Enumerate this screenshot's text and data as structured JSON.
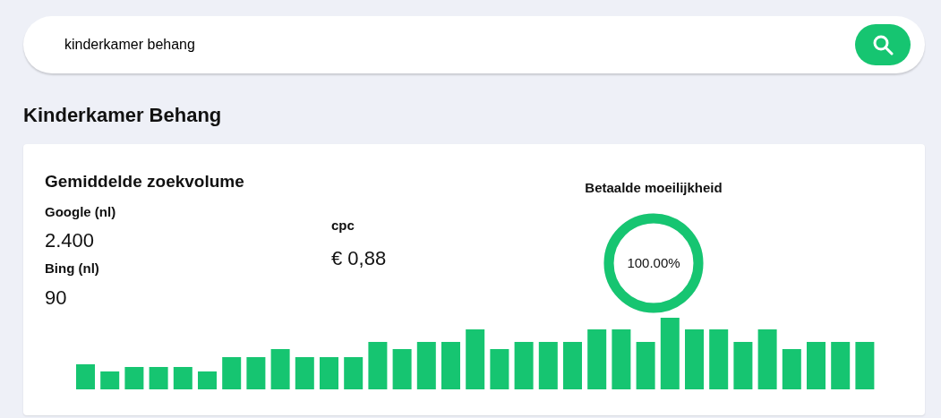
{
  "search": {
    "value": "kinderkamer behang"
  },
  "heading": "Kinderkamer Behang",
  "card": {
    "title": "Gemiddelde zoekvolume",
    "volumes": [
      {
        "label": "Google (nl)",
        "value": "2.400"
      },
      {
        "label": "Bing (nl)",
        "value": "90"
      }
    ],
    "cpc": {
      "label": "cpc",
      "value": "€ 0,88"
    },
    "difficulty": {
      "label": "Betaalde moeilijkheid",
      "reading": "100.00%",
      "level": 1
    }
  }
}
